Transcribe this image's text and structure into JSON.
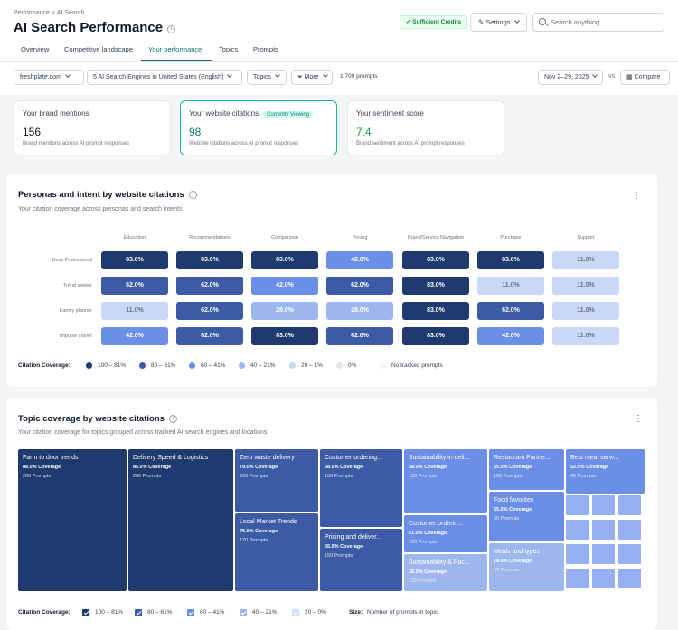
{
  "header": {
    "breadcrumb": "Performance > AI Search",
    "title": "AI Search Performance",
    "credits": "Sufficient Credits",
    "settings": "Settings",
    "search_placeholder": "Search anything"
  },
  "tabs": [
    {
      "label": "Overview",
      "active": false
    },
    {
      "label": "Competitive landscape",
      "active": false
    },
    {
      "label": "Your performance",
      "active": true
    },
    {
      "label": "Topics",
      "active": false
    },
    {
      "label": "Prompts",
      "active": false
    }
  ],
  "filters": {
    "domain": "freshplate.com",
    "engines": "5 AI Search Engines in United States (English)",
    "topics": "Topics",
    "more": "More",
    "prompts_count": "1,700 prompts",
    "date_range": "Nov 2–29, 2025",
    "vs": "vs",
    "compare": "Compare"
  },
  "cards": [
    {
      "title": "Your brand mentions",
      "value": "156",
      "sub": "Brand mentions across AI prompt responses",
      "badge": "",
      "value_color": "#111827"
    },
    {
      "title": "Your website citations",
      "value": "98",
      "sub": "Website citations across AI prompt responses",
      "badge": "Currently Viewing",
      "value_color": "#0f766e"
    },
    {
      "title": "Your sentiment score",
      "value": "7.4",
      "sub": "Brand sentiment across AI prompt responses",
      "badge": "",
      "value_color": "#16a34a"
    }
  ],
  "personas": {
    "title": "Personas and intent by website citations",
    "subtitle": "Your citation coverage across personas and search intents",
    "columns": [
      "Education",
      "Recommendations",
      "Comparison",
      "Pricing",
      "Brand/Service Navigation",
      "Purchase",
      "Support"
    ],
    "rows": [
      {
        "name": "Busy Professional",
        "values": [
          "83.0%",
          "83.0%",
          "83.0%",
          "42.0%",
          "83.0%",
          "83.0%",
          "11.0%"
        ]
      },
      {
        "name": "Trend seeker",
        "values": [
          "62.0%",
          "62.0%",
          "42.0%",
          "62.0%",
          "83.0%",
          "11.0%",
          "11.0%"
        ]
      },
      {
        "name": "Family planner",
        "values": [
          "11.0%",
          "62.0%",
          "28.0%",
          "28.0%",
          "83.0%",
          "62.0%",
          "11.0%"
        ]
      },
      {
        "name": "Impulse craver",
        "values": [
          "42.0%",
          "62.0%",
          "83.0%",
          "62.0%",
          "83.0%",
          "42.0%",
          "11.0%"
        ]
      }
    ],
    "legend_label": "Citation Coverage:",
    "legend": [
      {
        "label": "100 – 81%",
        "color": "#1e3a6e"
      },
      {
        "label": "80 – 61%",
        "color": "#3b5ba5"
      },
      {
        "label": "60 – 41%",
        "color": "#6b8fe6"
      },
      {
        "label": "40 – 21%",
        "color": "#9db7ee"
      },
      {
        "label": "20 – 1%",
        "color": "#c9d8f6"
      },
      {
        "label": "0%",
        "color": "#e5e7eb"
      },
      {
        "label": "No tracked prompts",
        "color": "#f5f5f5"
      }
    ]
  },
  "topics": {
    "title": "Topic coverage by website citations",
    "subtitle": "Your citation coverage for topics grouped across tracked AI search engines and locations",
    "tiles": [
      {
        "name": "Farm to door trends",
        "coverage": "88.0% Coverage",
        "prompts": "200 Prompts",
        "color": "#1e3a6e"
      },
      {
        "name": "Delivery Speed & Logistics",
        "coverage": "85.0% Coverage",
        "prompts": "200 Prompts",
        "color": "#1e3a6e"
      },
      {
        "name": "Zero waste delivery",
        "coverage": "79.0% Coverage",
        "prompts": "200 Prompts",
        "color": "#3b5ba5"
      },
      {
        "name": "Local Market Trends",
        "coverage": "75.0% Coverage",
        "prompts": "170 Prompts",
        "color": "#3b5ba5"
      },
      {
        "name": "Customer ordering...",
        "coverage": "68.0% Coverage",
        "prompts": "150 Prompts",
        "color": "#3b5ba5"
      },
      {
        "name": "Pricing and deliver...",
        "coverage": "65.0% Coverage",
        "prompts": "150 Prompts",
        "color": "#3b5ba5"
      },
      {
        "name": "Sustainability in deli...",
        "coverage": "58.0% Coverage",
        "prompts": "120 Prompts",
        "color": "#6b8fe6"
      },
      {
        "name": "Customer orderin...",
        "coverage": "51.0% Coverage",
        "prompts": "120 Prompts",
        "color": "#6b8fe6"
      },
      {
        "name": "Sustainability & Pac...",
        "coverage": "32.0% Coverage",
        "prompts": "110 Prompts",
        "color": "#9db7ee"
      },
      {
        "name": "Restaurant Partne...",
        "coverage": "55.0% Coverage",
        "prompts": "100 Prompts",
        "color": "#6b8fe6"
      },
      {
        "name": "Food favorites",
        "coverage": "55.0% Coverage",
        "prompts": "50 Prompts",
        "color": "#6b8fe6"
      },
      {
        "name": "Meals and types",
        "coverage": "18.0% Coverage",
        "prompts": "50 Prompts",
        "color": "#9db7ee"
      },
      {
        "name": "Best meal servi...",
        "coverage": "52.0% Coverage",
        "prompts": "40 Prompts",
        "color": "#6b8fe6"
      }
    ],
    "legend_label": "Citation Coverage:",
    "legend": [
      {
        "label": "100 – 81%",
        "color": "#1e3a6e"
      },
      {
        "label": "80 – 61%",
        "color": "#3b5ba5"
      },
      {
        "label": "60 – 41%",
        "color": "#6b8fe6"
      },
      {
        "label": "40 – 21%",
        "color": "#9db7ee"
      },
      {
        "label": "20 – 0%",
        "color": "#d1dcf5"
      }
    ],
    "size_label": "Size:",
    "size_desc": "Number of prompts in topic"
  }
}
